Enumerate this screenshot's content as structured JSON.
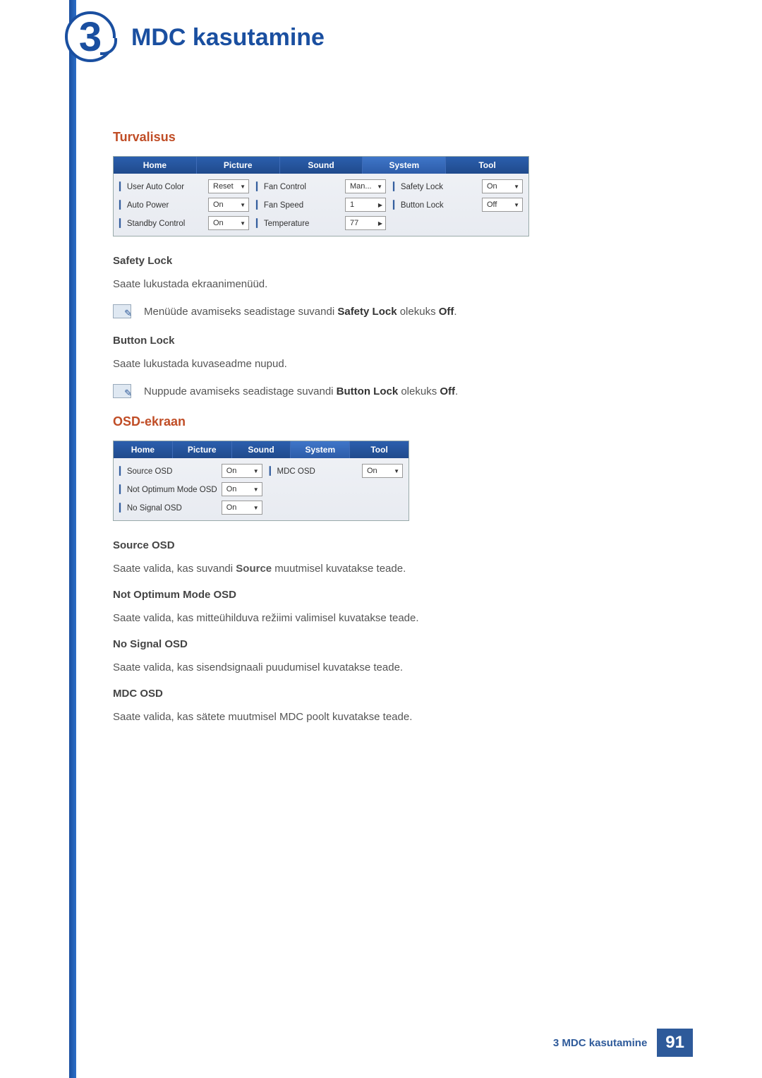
{
  "chapter": {
    "number": "3",
    "title": "MDC kasutamine"
  },
  "security": {
    "heading": "Turvalisus",
    "tabs": [
      "Home",
      "Picture",
      "Sound",
      "System",
      "Tool"
    ],
    "cols": [
      [
        {
          "label": "User Auto Color",
          "value": "Reset",
          "ctl": "dd"
        },
        {
          "label": "Auto Power",
          "value": "On",
          "ctl": "dd"
        },
        {
          "label": "Standby Control",
          "value": "On",
          "ctl": "dd"
        }
      ],
      [
        {
          "label": "Fan Control",
          "value": "Man...",
          "ctl": "dd"
        },
        {
          "label": "Fan Speed",
          "value": "1",
          "ctl": "sp"
        },
        {
          "label": "Temperature",
          "value": "77",
          "ctl": "sp"
        }
      ],
      [
        {
          "label": "Safety Lock",
          "value": "On",
          "ctl": "dd"
        },
        {
          "label": "Button Lock",
          "value": "Off",
          "ctl": "dd"
        }
      ]
    ],
    "safety_lock": {
      "title": "Safety Lock",
      "desc": "Saate lukustada ekraanimenüüd.",
      "note_pre": "Menüüde avamiseks seadistage suvandi ",
      "note_bold": "Safety Lock",
      "note_mid": " olekuks ",
      "note_bold2": "Off",
      "note_post": "."
    },
    "button_lock": {
      "title": "Button Lock",
      "desc": "Saate lukustada kuvaseadme nupud.",
      "note_pre": "Nuppude avamiseks seadistage suvandi ",
      "note_bold": "Button Lock",
      "note_mid": " olekuks ",
      "note_bold2": "Off",
      "note_post": "."
    }
  },
  "osd": {
    "heading": "OSD-ekraan",
    "tabs": [
      "Home",
      "Picture",
      "Sound",
      "System",
      "Tool"
    ],
    "cols": [
      [
        {
          "label": "Source OSD",
          "value": "On",
          "ctl": "dd"
        },
        {
          "label": "Not Optimum Mode OSD",
          "value": "On",
          "ctl": "dd"
        },
        {
          "label": "No Signal OSD",
          "value": "On",
          "ctl": "dd"
        }
      ],
      [
        {
          "label": "MDC OSD",
          "value": "On",
          "ctl": "dd"
        }
      ]
    ],
    "items": [
      {
        "title": "Source OSD",
        "desc_pre": "Saate valida, kas suvandi ",
        "bold": "Source",
        "desc_post": " muutmisel kuvatakse teade."
      },
      {
        "title": "Not Optimum Mode OSD",
        "desc": "Saate valida, kas mitteühilduva režiimi valimisel kuvatakse teade."
      },
      {
        "title": "No Signal OSD",
        "desc": "Saate valida, kas sisendsignaali puudumisel kuvatakse teade."
      },
      {
        "title": "MDC OSD",
        "desc": "Saate valida, kas sätete muutmisel MDC poolt kuvatakse teade."
      }
    ]
  },
  "footer": {
    "text": "3 MDC kasutamine",
    "page": "91"
  }
}
